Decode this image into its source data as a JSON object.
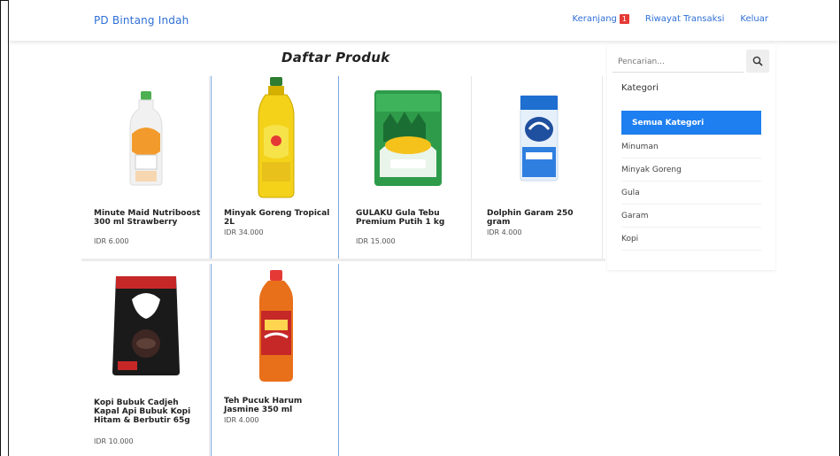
{
  "header": {
    "brand": "PD Bintang Indah",
    "nav": [
      {
        "label": "Keranjang",
        "badge": "1"
      },
      {
        "label": "Riwayat Transaksi"
      },
      {
        "label": "Keluar"
      }
    ]
  },
  "main": {
    "title": "Daftar Produk",
    "products": [
      {
        "name": "Minute Maid Nutriboost 300 ml Strawberry",
        "price": "IDR 6.000",
        "icon": "juice-bottle-icon"
      },
      {
        "name": "Minyak Goreng Tropical 2L",
        "price": "IDR 34.000",
        "icon": "oil-bottle-icon"
      },
      {
        "name": "GULAKU Gula Tebu Premium Putih 1 kg",
        "price": "IDR 15.000",
        "icon": "sugar-pack-icon"
      },
      {
        "name": "Dolphin Garam 250 gram",
        "price": "IDR 4.000",
        "icon": "salt-pack-icon"
      },
      {
        "name": "Kopi Bubuk Cadjeh Kapal Api Bubuk Kopi Hitam & Berbutir 65g",
        "price": "IDR 10.000",
        "icon": "coffee-pack-icon"
      },
      {
        "name": "Teh Pucuk Harum Jasmine 350 ml",
        "price": "IDR 4.000",
        "icon": "tea-bottle-icon"
      }
    ]
  },
  "sidebar": {
    "search_placeholder": "Pencarian...",
    "categories_heading": "Kategori",
    "categories": [
      {
        "label": "Semua Kategori",
        "active": true
      },
      {
        "label": "Minuman"
      },
      {
        "label": "Minyak Goreng"
      },
      {
        "label": "Gula"
      },
      {
        "label": "Garam"
      },
      {
        "label": "Kopi"
      }
    ]
  },
  "colors": {
    "accent": "#1e7ff0",
    "link": "#2f6fd6",
    "badge": "#e53935"
  }
}
